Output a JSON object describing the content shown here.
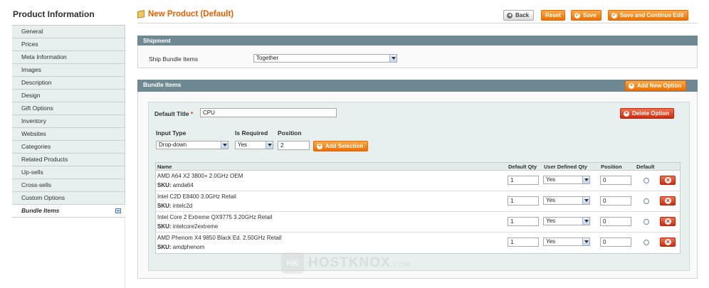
{
  "sidebar": {
    "title": "Product Information",
    "items": [
      {
        "label": "General"
      },
      {
        "label": "Prices"
      },
      {
        "label": "Meta Information"
      },
      {
        "label": "Images"
      },
      {
        "label": "Description"
      },
      {
        "label": "Design"
      },
      {
        "label": "Gift Options"
      },
      {
        "label": "Inventory"
      },
      {
        "label": "Websites"
      },
      {
        "label": "Categories"
      },
      {
        "label": "Related Products"
      },
      {
        "label": "Up-sells"
      },
      {
        "label": "Cross-sells"
      },
      {
        "label": "Custom Options"
      },
      {
        "label": "Bundle Items",
        "active": true
      }
    ]
  },
  "header": {
    "title": "New Product (Default)",
    "buttons": {
      "back": "Back",
      "reset": "Reset",
      "save": "Save",
      "save_continue": "Save and Continue Edit"
    }
  },
  "shipment": {
    "heading": "Shipment",
    "ship_label": "Ship Bundle Items",
    "ship_value": "Together"
  },
  "bundle": {
    "heading": "Bundle Items",
    "add_option": "Add New Option",
    "default_title_label": "Default Title",
    "required_mark": "*",
    "default_title_value": "CPU",
    "delete_option": "Delete Option",
    "input_type_label": "Input Type",
    "input_type_value": "Drop-down",
    "is_required_label": "Is Required",
    "is_required_value": "Yes",
    "position_label": "Position",
    "position_value": "2",
    "add_selection": "Add Selection",
    "columns": {
      "name": "Name",
      "default_qty": "Default Qty",
      "user_defined_qty": "User Defined Qty",
      "position": "Position",
      "default": "Default"
    },
    "sku_label": "SKU:",
    "rows": [
      {
        "name": "AMD A64 X2 3800+ 2.0GHz OEM",
        "sku": "amda64",
        "qty": "1",
        "user_defined": "Yes",
        "position": "0"
      },
      {
        "name": "Intel C2D E8400 3.0GHz Retail",
        "sku": "intelc2d",
        "qty": "1",
        "user_defined": "Yes",
        "position": "0"
      },
      {
        "name": "Intel Core 2 Extreme QX9775 3.20GHz Retail",
        "sku": "intelcore2extreme",
        "qty": "1",
        "user_defined": "Yes",
        "position": "0"
      },
      {
        "name": "AMD Phenom X4 9850 Black Ed. 2.50GHz Retail",
        "sku": "amdphenom",
        "qty": "1",
        "user_defined": "Yes",
        "position": "0"
      }
    ]
  },
  "watermark": {
    "logo": "HK",
    "text": "HOSTKNOX",
    "suffix": ".COM"
  },
  "colors": {
    "accent": "#eb5e00",
    "section_head": "#6f8992",
    "delete": "#cf2a0e"
  }
}
